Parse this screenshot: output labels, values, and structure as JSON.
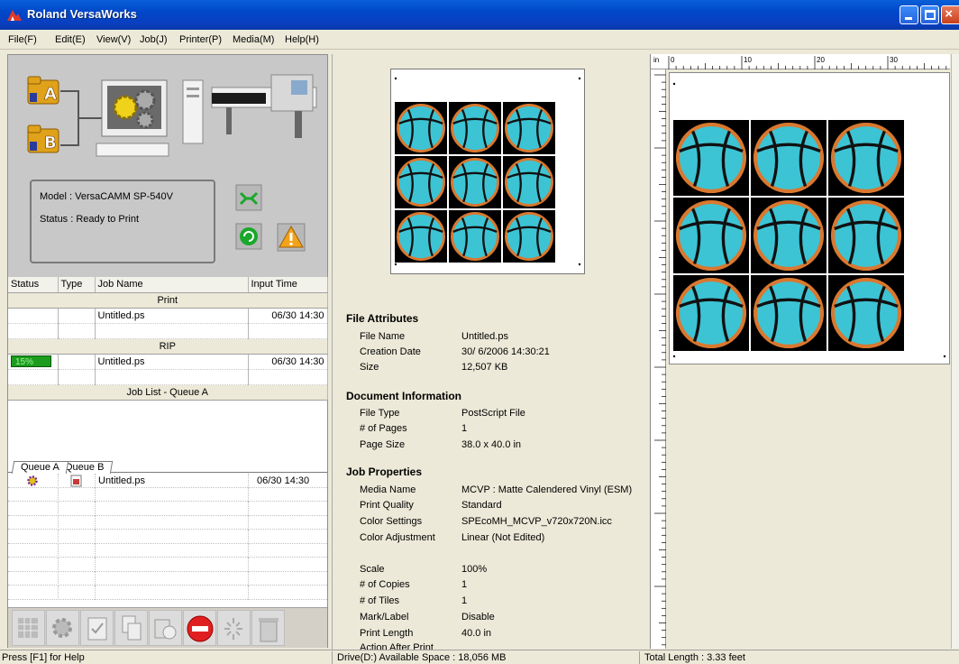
{
  "window": {
    "title": "Roland VersaWorks"
  },
  "menu": [
    "File(F)",
    "Edit(E)",
    "View(V)",
    "Job(J)",
    "Printer(P)",
    "Media(M)",
    "Help(H)"
  ],
  "printer": {
    "queue_a": "A",
    "queue_b": "B",
    "model": "Model : VersaCAMM SP-540V",
    "status": "Status : Ready to Print"
  },
  "job_table": {
    "headers": [
      "Status",
      "Type",
      "Job Name",
      "Input Time"
    ],
    "print_section": "Print",
    "print_row": {
      "name": "Untitled.ps",
      "time": "06/30 14:30"
    },
    "rip_section": "RIP",
    "rip_row": {
      "progress": "15%",
      "progress_value": 0.15,
      "name": "Untitled.ps",
      "time": "06/30 14:30"
    },
    "queue_section": "Job List - Queue A"
  },
  "queue_tabs": [
    "Queue A",
    "Queue B"
  ],
  "queue_rows": [
    {
      "name": "Untitled.ps",
      "time": "06/30 14:30"
    }
  ],
  "file_attributes": {
    "heading": "File Attributes",
    "rows": [
      {
        "label": "File Name",
        "value": "Untitled.ps"
      },
      {
        "label": "Creation Date",
        "value": "30/ 6/2006 14:30:21"
      },
      {
        "label": "Size",
        "value": "12,507 KB"
      }
    ]
  },
  "document_information": {
    "heading": "Document Information",
    "rows": [
      {
        "label": "File Type",
        "value": "PostScript File"
      },
      {
        "label": "# of Pages",
        "value": "1"
      },
      {
        "label": "Page Size",
        "value": "38.0 x 40.0 in"
      }
    ]
  },
  "job_properties": {
    "heading": "Job Properties",
    "rows": [
      {
        "label": "Media Name",
        "value": "MCVP : Matte Calendered Vinyl (ESM)"
      },
      {
        "label": "Print Quality",
        "value": "Standard"
      },
      {
        "label": "Color Settings",
        "value": "SPEcoMH_MCVP_v720x720N.icc"
      },
      {
        "label": "Color Adjustment",
        "value": "Linear (Not Edited)"
      }
    ],
    "rows2": [
      {
        "label": "Scale",
        "value": "100%"
      },
      {
        "label": "# of Copies",
        "value": "1"
      },
      {
        "label": "# of Tiles",
        "value": "1"
      },
      {
        "label": "Mark/Label",
        "value": "Disable"
      },
      {
        "label": "Print Length",
        "value": "40.0 in"
      },
      {
        "label": "Action After Print",
        "value": ""
      }
    ]
  },
  "ruler": {
    "unit": "in",
    "ticks": [
      "0",
      "10",
      "20",
      "30"
    ]
  },
  "statusbar": {
    "help": "Press [F1] for Help",
    "drive": "Drive(D:) Available Space : 18,056 MB",
    "length": "Total Length : 3.33 feet"
  },
  "colors": {
    "accent": "#0a5fd8",
    "tile_fill": "#3cc4d4",
    "tile_ring": "#d9782f"
  }
}
